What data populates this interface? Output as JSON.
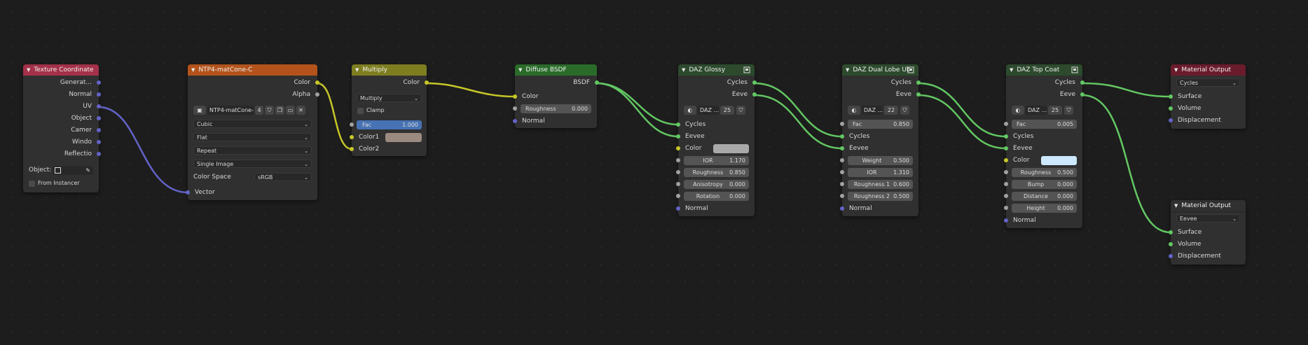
{
  "colors": {
    "bg": "#1d1d1d",
    "hdr_texture_coord": "#a33149",
    "hdr_image": "#b3531b",
    "hdr_multiply": "#7e7e21",
    "hdr_shader": "#2a6b2a",
    "hdr_group": "#2d4a2d",
    "hdr_output": "#6a1c2c",
    "wire_vector": "#6363c7",
    "wire_color": "#c7c729",
    "wire_shader": "#63c763"
  },
  "texcoord": {
    "title": "Texture Coordinate",
    "outputs": [
      "Generat...",
      "Normal",
      "UV",
      "Object",
      "Camer",
      "Windo",
      "Reflectio"
    ],
    "object_label": "Object:",
    "from_instancer": "From Instancer"
  },
  "image": {
    "title": "NTP4-matCone-C",
    "out_color": "Color",
    "out_alpha": "Alpha",
    "image_name": "NTP4-matCone-C",
    "users": "4",
    "interpolation": "Cubic",
    "projection": "Flat",
    "extension": "Repeat",
    "source": "Single Image",
    "colorspace_label": "Color Space",
    "colorspace": "sRGB",
    "in_vector": "Vector"
  },
  "multiply": {
    "title": "Multiply",
    "out_color": "Color",
    "blend": "Multiply",
    "clamp": "Clamp",
    "fac_label": "Fac",
    "fac_value": "1.000",
    "color1": "Color1",
    "color2": "Color2",
    "color1_swatch": "#9b8a7f"
  },
  "diffuse": {
    "title": "Diffuse BSDF",
    "out_bsdf": "BSDF",
    "in_color": "Color",
    "roughness_label": "Roughness",
    "roughness_value": "0.000",
    "in_normal": "Normal"
  },
  "glossy": {
    "title": "DAZ Glossy",
    "out_cycles": "Cycles",
    "out_eeve": "Eeve",
    "group_name": "DAZ ...",
    "users": "25",
    "in_cycles": "Cycles",
    "in_eevee": "Eevee",
    "color_label": "Color",
    "color_swatch": "#a9a9a9",
    "ior_label": "IOR",
    "ior_value": "1.170",
    "rough_label": "Roughness",
    "rough_value": "0.850",
    "aniso_label": "Anisotropy",
    "aniso_value": "0.000",
    "rot_label": "Rotation",
    "rot_value": "0.000",
    "in_normal": "Normal"
  },
  "duallobe": {
    "title": "DAZ Dual Lobe Ub",
    "out_cycles": "Cycles",
    "out_eeve": "Eeve",
    "group_name": "DAZ ...",
    "users": "22",
    "fac_label": "Fac",
    "fac_value": "0.850",
    "in_cycles": "Cycles",
    "in_eevee": "Eevee",
    "weight_label": "Weight",
    "weight_value": "0.500",
    "ior_label": "IOR",
    "ior_value": "1.310",
    "r1_label": "Roughness 1",
    "r1_value": "0.600",
    "r2_label": "Roughness 2",
    "r2_value": "0.500",
    "in_normal": "Normal"
  },
  "topcoat": {
    "title": "DAZ Top Coat",
    "out_cycles": "Cycles",
    "out_eeve": "Eeve",
    "group_name": "DAZ ...",
    "users": "25",
    "fac_label": "Fac",
    "fac_value": "0.005",
    "in_cycles": "Cycles",
    "in_eevee": "Eevee",
    "color_label": "Color",
    "color_swatch": "#cde9ff",
    "rough_label": "Roughness",
    "rough_value": "0.500",
    "bump_label": "Bump",
    "bump_value": "0.000",
    "dist_label": "Distance",
    "dist_value": "0.000",
    "height_label": "Height",
    "height_value": "0.000",
    "in_normal": "Normal"
  },
  "output1": {
    "title": "Material Output",
    "target": "Cycles",
    "surface": "Surface",
    "volume": "Volume",
    "displacement": "Displacement"
  },
  "output2": {
    "title": "Material Output",
    "target": "Eevee",
    "surface": "Surface",
    "volume": "Volume",
    "displacement": "Displacement"
  }
}
